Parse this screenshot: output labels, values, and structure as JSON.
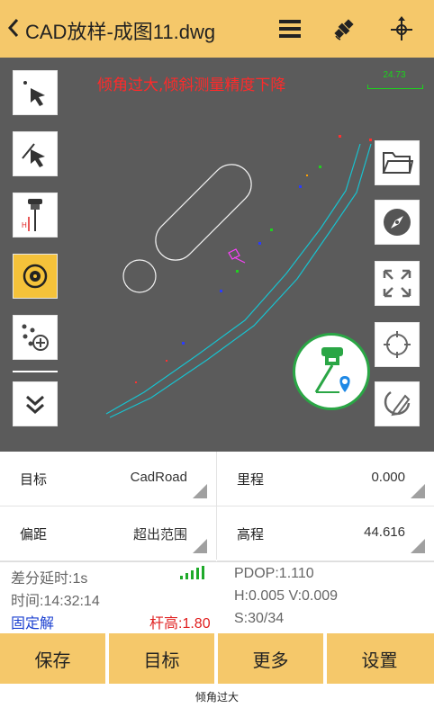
{
  "header": {
    "back_icon": "chevron-left-icon",
    "title": "CAD放样-成图11.dwg",
    "icons": [
      "list-menu-icon",
      "satellite-icon",
      "crosshair-icon"
    ]
  },
  "map": {
    "warning": "倾角过大,倾斜测量精度下降",
    "scale_label": "24.73",
    "left_tools": [
      "select-arrow-icon",
      "select-line-icon",
      "rover-pole-icon",
      "target-point-icon",
      "add-points-icon",
      "expand-more-icon"
    ],
    "right_tools": [
      "folder-icon",
      "compass-icon",
      "fit-extent-icon",
      "locate-icon",
      "draw-icon"
    ],
    "fab_icon": "stakeout-rover-icon"
  },
  "fields": {
    "target_label": "目标",
    "target_value": "CadRoad",
    "mileage_label": "里程",
    "mileage_value": "0.000",
    "offset_label": "偏距",
    "offset_value": "超出范围",
    "elevation_label": "高程",
    "elevation_value": "44.616"
  },
  "status": {
    "diff_delay": "差分延时:1s",
    "time": "时间:14:32:14",
    "solution": "固定解",
    "pole_height": "杆高:1.80",
    "pdop": "PDOP:1.110",
    "hv": "H:0.005  V:0.009",
    "sats": "S:30/34",
    "signal_icon": "signal-bars-icon"
  },
  "actions": {
    "save": "保存",
    "target": "目标",
    "more": "更多",
    "settings": "设置"
  },
  "toast": "倾角过大",
  "colors": {
    "accent": "#f5c86a",
    "map_bg": "#5b5b5b",
    "warning": "#ff2a2a",
    "fixed_solution": "#1a3fd0",
    "pole_height": "#e02020",
    "signal": "#1faa2a"
  }
}
